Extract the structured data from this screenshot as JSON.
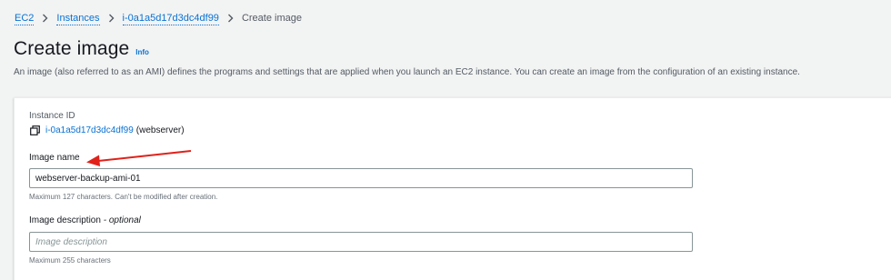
{
  "breadcrumb": {
    "items": [
      "EC2",
      "Instances",
      "i-0a1a5d17d3dc4df99"
    ],
    "current": "Create image"
  },
  "header": {
    "title": "Create image",
    "info": "Info",
    "description": "An image (also referred to as an AMI) defines the programs and settings that are applied when you launch an EC2 instance. You can create an image from the configuration of an existing instance."
  },
  "form": {
    "instance_id_label": "Instance ID",
    "instance_id": "i-0a1a5d17d3dc4df99",
    "instance_name": "(webserver)",
    "image_name_label": "Image name",
    "image_name_value": "webserver-backup-ami-01",
    "image_name_hint": "Maximum 127 characters. Can't be modified after creation.",
    "image_description_label": "Image description",
    "image_description_optional": "- optional",
    "image_description_placeholder": "Image description",
    "image_description_hint": "Maximum 255 characters"
  },
  "colors": {
    "link": "#0972d3",
    "annotation_arrow": "#e0221b",
    "background": "#f2f3f3"
  }
}
